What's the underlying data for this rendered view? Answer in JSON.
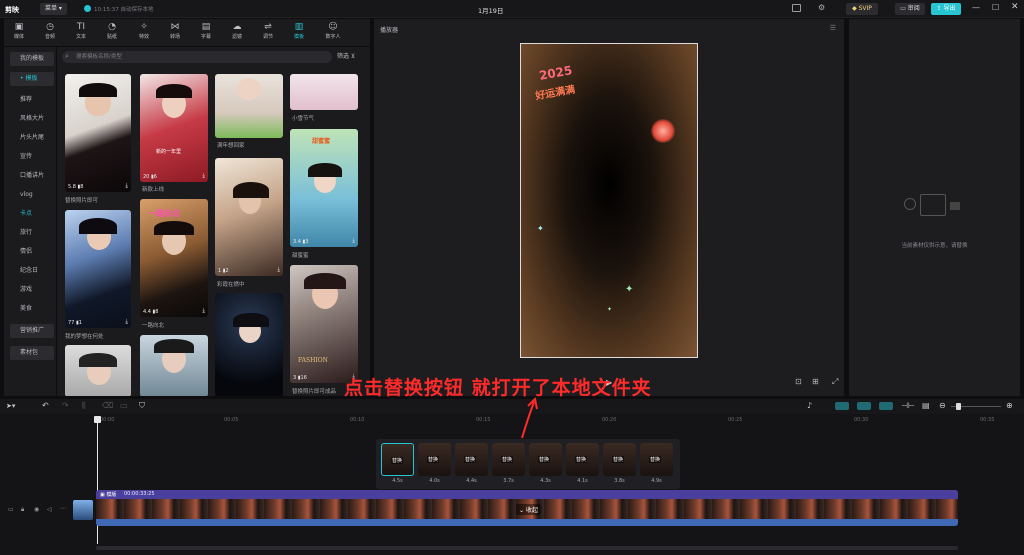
{
  "titlebar": {
    "app_name": "剪映",
    "menu_label": "菜单",
    "autosave": "10:15:37 自动保存本地",
    "project_title": "1月19日",
    "vip_label": "SVIP",
    "review_label": "审阅",
    "export_label": "导出"
  },
  "toolbar": {
    "items": [
      {
        "label": "媒体",
        "icon": "media-icon"
      },
      {
        "label": "音频",
        "icon": "audio-icon"
      },
      {
        "label": "文本",
        "icon": "text-icon"
      },
      {
        "label": "贴纸",
        "icon": "sticker-icon"
      },
      {
        "label": "特效",
        "icon": "effects-icon"
      },
      {
        "label": "转场",
        "icon": "transition-icon"
      },
      {
        "label": "字幕",
        "icon": "subtitle-icon"
      },
      {
        "label": "滤镜",
        "icon": "filter-icon"
      },
      {
        "label": "调节",
        "icon": "adjust-icon"
      },
      {
        "label": "模板",
        "icon": "template-icon"
      },
      {
        "label": "数字人",
        "icon": "avatar-icon"
      }
    ],
    "active_index": 9
  },
  "leftnav": {
    "header": "我的模板",
    "items": [
      "• 模板",
      "推荐",
      "风格大片",
      "片头片尾",
      "宣传",
      "口播讲片",
      "vlog",
      "卡点",
      "旅行",
      "情侣",
      "纪念日",
      "游戏",
      "美食",
      "营销推广",
      "素材包"
    ],
    "selected_index": 0,
    "highlight_index": 7
  },
  "panel": {
    "search_placeholder": "搜索模板名称/类型",
    "filter_label": "筛选",
    "cards": [
      {
        "title": "替换照片即可",
        "meta": "5.8  ▮8"
      },
      {
        "title": "新款上线",
        "meta": "20  ▮6"
      },
      {
        "title": "满年想回家",
        "meta": "13  ▮9"
      },
      {
        "title": "小雪节气",
        "meta": ""
      },
      {
        "title": "我的梦想在何处",
        "meta": "77  ▮1"
      },
      {
        "title": "一路向北",
        "meta": "4.4  ▮8"
      },
      {
        "title": "彩霞在燃中",
        "meta": "1  ▮2"
      },
      {
        "title": "甜蜜蜜",
        "meta": "3.4  ▮3"
      },
      {
        "title": "替换照片即可成品",
        "meta": "3  ▮16"
      }
    ],
    "card_text": {
      "t1": "新的一年里",
      "t2": "一路向北",
      "t3": "好运满满",
      "t4": "甜蜜蜜",
      "t5": "FASHION"
    }
  },
  "player": {
    "title": "播放器",
    "overlay_year": "2025",
    "overlay_text": "好运满满"
  },
  "right": {
    "empty_text": "当前素材仅供示意，请替换"
  },
  "caption": "点击替换按钮 就打开了本地文件夹",
  "timeline": {
    "ticks": [
      "00:00",
      "00:05",
      "00:10",
      "00:15",
      "00:20",
      "00:25",
      "00:30",
      "00:35"
    ],
    "track_name": "模版",
    "track_duration": "00:00:33:25",
    "collapse_label": "收起",
    "clip_label": "替换",
    "clips": [
      "4.5s",
      "4.0s",
      "4.4s",
      "3.7s",
      "4.3s",
      "4.1s",
      "3.8s",
      "4.9s"
    ]
  },
  "colors": {
    "accent": "#27c4d1",
    "caption": "#ff2a2a",
    "track": "#5a4fb0"
  }
}
